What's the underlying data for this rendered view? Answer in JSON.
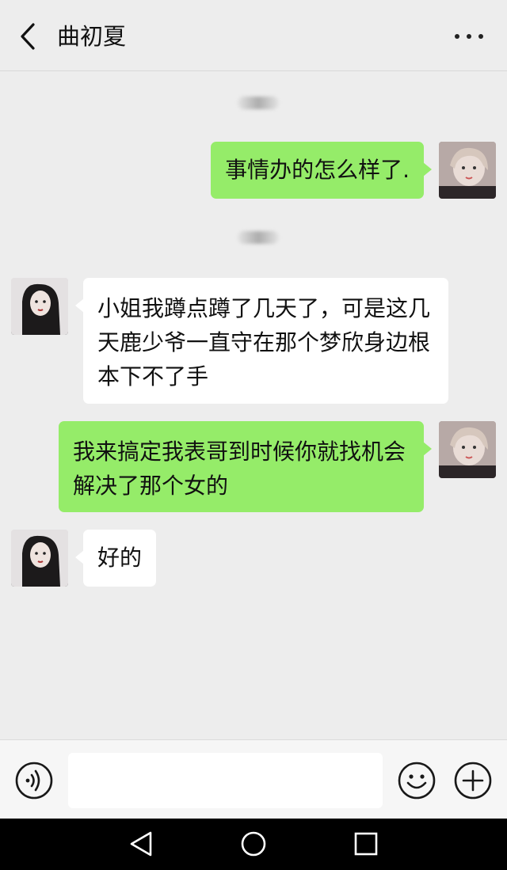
{
  "header": {
    "contact_name": "曲初夏",
    "back_icon": "chevron-left-icon",
    "more_icon": "more-dots-icon"
  },
  "messages": [
    {
      "sender": "me",
      "text": "事情办的怎么样了."
    },
    {
      "sender": "other",
      "text": "小姐我蹲点蹲了几天了，可是这几天鹿少爷一直守在那个梦欣身边根本下不了手"
    },
    {
      "sender": "me",
      "text": "我来搞定我表哥到时候你就找机会解决了那个女的"
    },
    {
      "sender": "other",
      "text": "好的"
    }
  ],
  "input_bar": {
    "voice_icon": "voice-icon",
    "text_value": "",
    "emoji_icon": "emoji-icon",
    "plus_icon": "plus-icon"
  },
  "nav_bar": {
    "back_icon": "triangle-back-icon",
    "home_icon": "circle-home-icon",
    "recents_icon": "square-recents-icon"
  },
  "colors": {
    "background": "#ededed",
    "my_bubble": "#95ec69",
    "other_bubble": "#ffffff",
    "nav_bar": "#000000"
  }
}
